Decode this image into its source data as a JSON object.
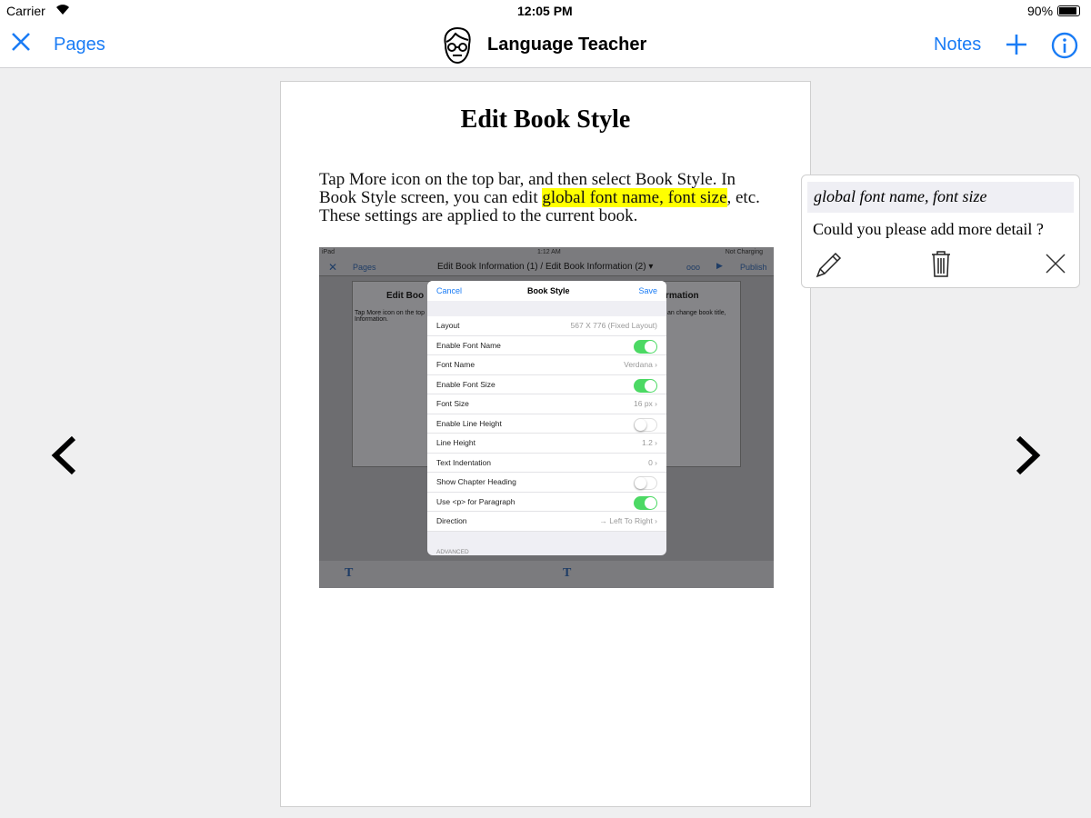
{
  "status": {
    "carrier": "Carrier",
    "time": "12:05 PM",
    "battery": "90%",
    "battery_level": 0.9
  },
  "nav": {
    "pages": "Pages",
    "title": "Language Teacher",
    "notes": "Notes"
  },
  "page": {
    "title": "Edit Book Style",
    "text_before": "Tap More icon on the top bar, and then select Book Style. In Book Style screen, you can edit ",
    "highlight": "global font name, font size",
    "text_after": ", etc. These settings are applied to the current book."
  },
  "shot": {
    "status": {
      "device": "iPad",
      "time": "1:12 AM",
      "charging": "Not Charging"
    },
    "nav": {
      "pages": "Pages",
      "title": "Edit Book Information (1) / Edit Book Information (2) ▾",
      "more": "ooo",
      "publish": "Publish"
    },
    "bg_left": {
      "title": "Edit Boo",
      "text": "Tap More icon on the top",
      "text2": "Information."
    },
    "bg_right": {
      "title": "rmation",
      "text": "an change book title,"
    },
    "modal": {
      "cancel": "Cancel",
      "title": "Book Style",
      "save": "Save",
      "advanced": "ADVANCED",
      "rows": [
        {
          "label": "Layout",
          "value": "567 X 776 (Fixed Layout)"
        },
        {
          "label": "Enable Font Name",
          "toggle": true
        },
        {
          "label": "Font Name",
          "value": "Verdana ›"
        },
        {
          "label": "Enable Font Size",
          "toggle": true
        },
        {
          "label": "Font Size",
          "value": "16 px ›"
        },
        {
          "label": "Enable Line Height",
          "toggle": false
        },
        {
          "label": "Line Height",
          "value": "1.2 ›"
        },
        {
          "label": "Text Indentation",
          "value": "0 ›"
        },
        {
          "label": "Show Chapter Heading",
          "toggle": false
        },
        {
          "label": "Use <p> for Paragraph",
          "toggle": true
        },
        {
          "label": "Direction",
          "value": "→ Left To Right ›"
        }
      ]
    }
  },
  "note": {
    "quote": "global font name, font size",
    "comment": "Could you please add more detail ?"
  },
  "colors": {
    "accent": "#1a7cf5",
    "highlight": "#ffff00",
    "toggle_on": "#4cd964"
  }
}
